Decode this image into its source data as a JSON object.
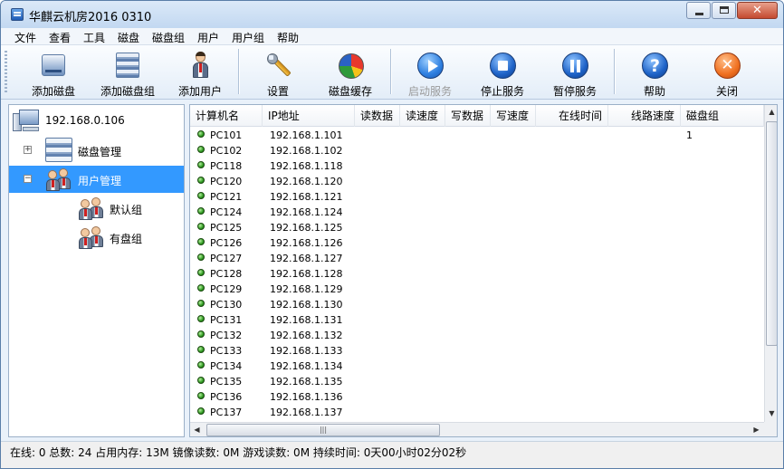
{
  "window": {
    "title": "华麒云机房2016 0310"
  },
  "menu": [
    "文件",
    "查看",
    "工具",
    "磁盘",
    "磁盘组",
    "用户",
    "用户组",
    "帮助"
  ],
  "toolbar": {
    "add_disk": "添加磁盘",
    "add_disk_group": "添加磁盘组",
    "add_user": "添加用户",
    "settings": "设置",
    "disk_cache": "磁盘缓存",
    "start_service": "启动服务",
    "stop_service": "停止服务",
    "pause_service": "暂停服务",
    "help": "帮助",
    "close": "关闭"
  },
  "tree": {
    "root": "192.168.0.106",
    "disk_manage": "磁盘管理",
    "user_manage": "用户管理",
    "default_group": "默认组",
    "disk_group": "有盘组"
  },
  "table": {
    "columns": [
      "计算机名",
      "IP地址",
      "读数据",
      "读速度",
      "写数据",
      "写速度",
      "在线时间",
      "线路速度",
      "磁盘组"
    ],
    "rows": [
      {
        "name": "PC101",
        "ip": "192.168.1.101",
        "group": "1"
      },
      {
        "name": "PC102",
        "ip": "192.168.1.102",
        "group": ""
      },
      {
        "name": "PC118",
        "ip": "192.168.1.118",
        "group": ""
      },
      {
        "name": "PC120",
        "ip": "192.168.1.120",
        "group": ""
      },
      {
        "name": "PC121",
        "ip": "192.168.1.121",
        "group": ""
      },
      {
        "name": "PC124",
        "ip": "192.168.1.124",
        "group": ""
      },
      {
        "name": "PC125",
        "ip": "192.168.1.125",
        "group": ""
      },
      {
        "name": "PC126",
        "ip": "192.168.1.126",
        "group": ""
      },
      {
        "name": "PC127",
        "ip": "192.168.1.127",
        "group": ""
      },
      {
        "name": "PC128",
        "ip": "192.168.1.128",
        "group": ""
      },
      {
        "name": "PC129",
        "ip": "192.168.1.129",
        "group": ""
      },
      {
        "name": "PC130",
        "ip": "192.168.1.130",
        "group": ""
      },
      {
        "name": "PC131",
        "ip": "192.168.1.131",
        "group": ""
      },
      {
        "name": "PC132",
        "ip": "192.168.1.132",
        "group": ""
      },
      {
        "name": "PC133",
        "ip": "192.168.1.133",
        "group": ""
      },
      {
        "name": "PC134",
        "ip": "192.168.1.134",
        "group": ""
      },
      {
        "name": "PC135",
        "ip": "192.168.1.135",
        "group": ""
      },
      {
        "name": "PC136",
        "ip": "192.168.1.136",
        "group": ""
      },
      {
        "name": "PC137",
        "ip": "192.168.1.137",
        "group": ""
      }
    ]
  },
  "status": "在线: 0 总数: 24 占用内存: 13M 镜像读数: 0M 游戏读数: 0M 持续时间: 0天00小时02分02秒"
}
